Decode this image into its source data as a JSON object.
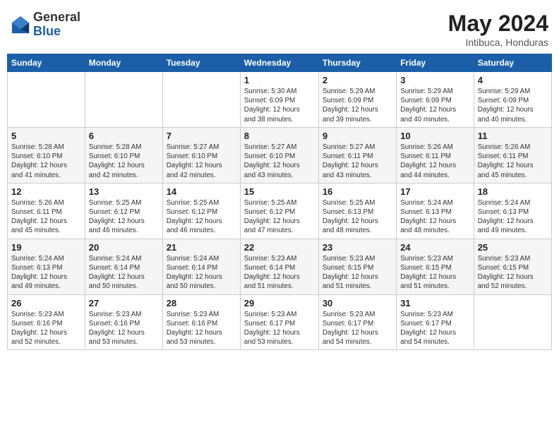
{
  "header": {
    "logo_general": "General",
    "logo_blue": "Blue",
    "month_year": "May 2024",
    "location": "Intibuca, Honduras"
  },
  "days_of_week": [
    "Sunday",
    "Monday",
    "Tuesday",
    "Wednesday",
    "Thursday",
    "Friday",
    "Saturday"
  ],
  "weeks": [
    {
      "cells": [
        {
          "day": "",
          "info": ""
        },
        {
          "day": "",
          "info": ""
        },
        {
          "day": "",
          "info": ""
        },
        {
          "day": "1",
          "info": "Sunrise: 5:30 AM\nSunset: 6:09 PM\nDaylight: 12 hours\nand 38 minutes."
        },
        {
          "day": "2",
          "info": "Sunrise: 5:29 AM\nSunset: 6:09 PM\nDaylight: 12 hours\nand 39 minutes."
        },
        {
          "day": "3",
          "info": "Sunrise: 5:29 AM\nSunset: 6:09 PM\nDaylight: 12 hours\nand 40 minutes."
        },
        {
          "day": "4",
          "info": "Sunrise: 5:29 AM\nSunset: 6:09 PM\nDaylight: 12 hours\nand 40 minutes."
        }
      ]
    },
    {
      "cells": [
        {
          "day": "5",
          "info": "Sunrise: 5:28 AM\nSunset: 6:10 PM\nDaylight: 12 hours\nand 41 minutes."
        },
        {
          "day": "6",
          "info": "Sunrise: 5:28 AM\nSunset: 6:10 PM\nDaylight: 12 hours\nand 42 minutes."
        },
        {
          "day": "7",
          "info": "Sunrise: 5:27 AM\nSunset: 6:10 PM\nDaylight: 12 hours\nand 42 minutes."
        },
        {
          "day": "8",
          "info": "Sunrise: 5:27 AM\nSunset: 6:10 PM\nDaylight: 12 hours\nand 43 minutes."
        },
        {
          "day": "9",
          "info": "Sunrise: 5:27 AM\nSunset: 6:11 PM\nDaylight: 12 hours\nand 43 minutes."
        },
        {
          "day": "10",
          "info": "Sunrise: 5:26 AM\nSunset: 6:11 PM\nDaylight: 12 hours\nand 44 minutes."
        },
        {
          "day": "11",
          "info": "Sunrise: 5:26 AM\nSunset: 6:11 PM\nDaylight: 12 hours\nand 45 minutes."
        }
      ]
    },
    {
      "cells": [
        {
          "day": "12",
          "info": "Sunrise: 5:26 AM\nSunset: 6:11 PM\nDaylight: 12 hours\nand 45 minutes."
        },
        {
          "day": "13",
          "info": "Sunrise: 5:25 AM\nSunset: 6:12 PM\nDaylight: 12 hours\nand 46 minutes."
        },
        {
          "day": "14",
          "info": "Sunrise: 5:25 AM\nSunset: 6:12 PM\nDaylight: 12 hours\nand 46 minutes."
        },
        {
          "day": "15",
          "info": "Sunrise: 5:25 AM\nSunset: 6:12 PM\nDaylight: 12 hours\nand 47 minutes."
        },
        {
          "day": "16",
          "info": "Sunrise: 5:25 AM\nSunset: 6:13 PM\nDaylight: 12 hours\nand 48 minutes."
        },
        {
          "day": "17",
          "info": "Sunrise: 5:24 AM\nSunset: 6:13 PM\nDaylight: 12 hours\nand 48 minutes."
        },
        {
          "day": "18",
          "info": "Sunrise: 5:24 AM\nSunset: 6:13 PM\nDaylight: 12 hours\nand 49 minutes."
        }
      ]
    },
    {
      "cells": [
        {
          "day": "19",
          "info": "Sunrise: 5:24 AM\nSunset: 6:13 PM\nDaylight: 12 hours\nand 49 minutes."
        },
        {
          "day": "20",
          "info": "Sunrise: 5:24 AM\nSunset: 6:14 PM\nDaylight: 12 hours\nand 50 minutes."
        },
        {
          "day": "21",
          "info": "Sunrise: 5:24 AM\nSunset: 6:14 PM\nDaylight: 12 hours\nand 50 minutes."
        },
        {
          "day": "22",
          "info": "Sunrise: 5:23 AM\nSunset: 6:14 PM\nDaylight: 12 hours\nand 51 minutes."
        },
        {
          "day": "23",
          "info": "Sunrise: 5:23 AM\nSunset: 6:15 PM\nDaylight: 12 hours\nand 51 minutes."
        },
        {
          "day": "24",
          "info": "Sunrise: 5:23 AM\nSunset: 6:15 PM\nDaylight: 12 hours\nand 51 minutes."
        },
        {
          "day": "25",
          "info": "Sunrise: 5:23 AM\nSunset: 6:15 PM\nDaylight: 12 hours\nand 52 minutes."
        }
      ]
    },
    {
      "cells": [
        {
          "day": "26",
          "info": "Sunrise: 5:23 AM\nSunset: 6:16 PM\nDaylight: 12 hours\nand 52 minutes."
        },
        {
          "day": "27",
          "info": "Sunrise: 5:23 AM\nSunset: 6:16 PM\nDaylight: 12 hours\nand 53 minutes."
        },
        {
          "day": "28",
          "info": "Sunrise: 5:23 AM\nSunset: 6:16 PM\nDaylight: 12 hours\nand 53 minutes."
        },
        {
          "day": "29",
          "info": "Sunrise: 5:23 AM\nSunset: 6:17 PM\nDaylight: 12 hours\nand 53 minutes."
        },
        {
          "day": "30",
          "info": "Sunrise: 5:23 AM\nSunset: 6:17 PM\nDaylight: 12 hours\nand 54 minutes."
        },
        {
          "day": "31",
          "info": "Sunrise: 5:23 AM\nSunset: 6:17 PM\nDaylight: 12 hours\nand 54 minutes."
        },
        {
          "day": "",
          "info": ""
        }
      ]
    }
  ]
}
